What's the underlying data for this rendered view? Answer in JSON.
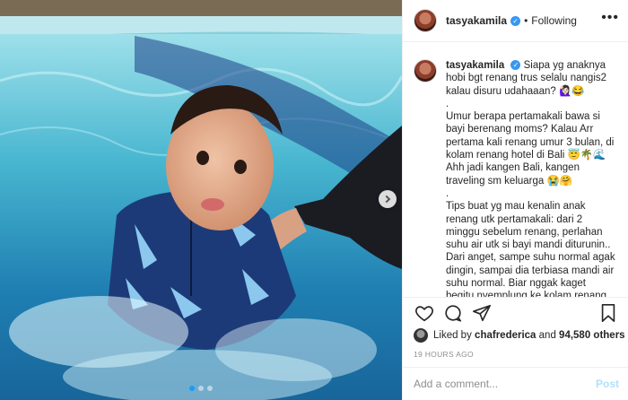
{
  "post": {
    "username": "tasyakamila",
    "follow_separator": "•",
    "follow_status": "Following",
    "more_options": "•••",
    "caption": "Siapa yg anaknya hobi bgt renang trus selalu nangis2 kalau disuru udahaaan? 🙋🏻‍♀️😂\n.\nUmur berapa pertamakali bawa si bayi berenang moms? Kalau Arr pertama kali renang umur 3 bulan, di kolam renang hotel di Bali 😇🌴🌊 Ahh jadi kangen Bali, kangen traveling sm keluarga 😭🤗\n.\nTips buat yg mau kenalin anak renang utk pertamakali: dari 2 minggu sebelum renang, perlahan suhu air utk si bayi mandi diturunin.. Dari anget, sampe suhu normal agak dingin, sampai dia terbiasa mandi air suhu normal. Biar nggak kaget begitu nyemplung ke kolam renang yg airnya dingin. Enjoy swim time with your lil",
    "likes": {
      "prefix": "Liked by",
      "liker": "chafrederica",
      "conjunction": "and",
      "count": "94,580 others"
    },
    "timestamp": "19 HOURS AGO",
    "comment_input": {
      "placeholder": "Add a comment...",
      "value": ""
    },
    "post_button": "Post"
  },
  "icons": {
    "verified": "verified-badge-icon",
    "like": "heart-icon",
    "comment": "comment-icon",
    "share": "share-icon",
    "save": "bookmark-icon",
    "next": "chevron-right-icon"
  },
  "colors": {
    "verified_blue": "#3897f0",
    "post_disabled": "#b2dffc",
    "muted_text": "#8e8e8e",
    "carousel_active_dot": "#1a9cf5"
  },
  "carousel": {
    "total_slides": 3,
    "active_slide": 1
  }
}
